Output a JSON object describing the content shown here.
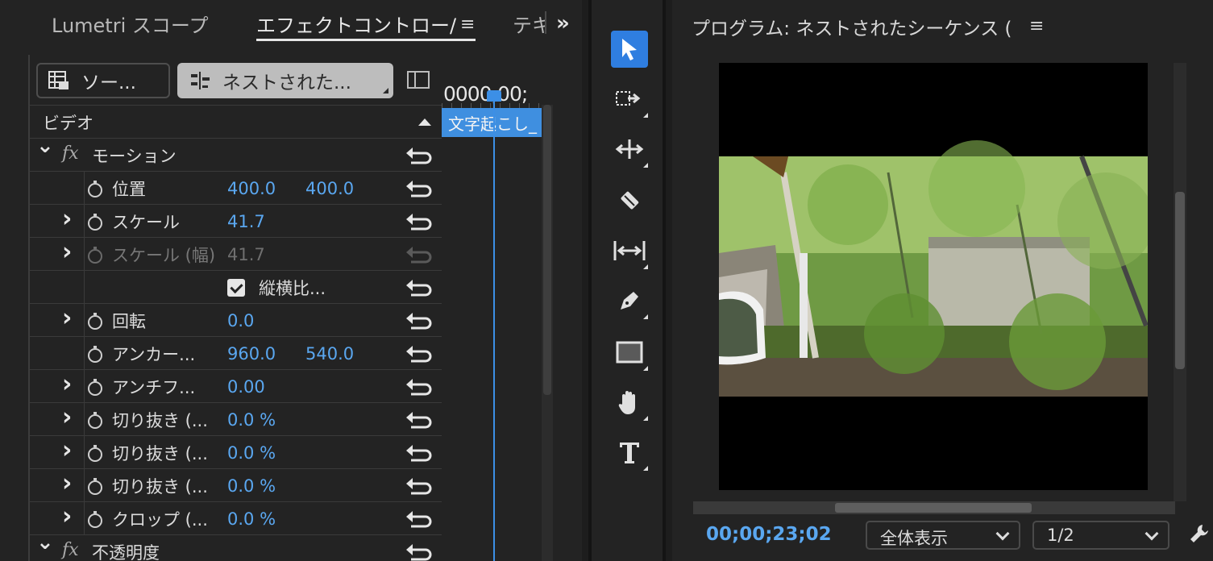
{
  "tabs": {
    "lumetri": "Lumetri スコープ",
    "effect_controls": "エフェクトコントロー/",
    "text": "テキ",
    "more_icon": "chevrons-right-icon",
    "menu_icon": "hamburger-icon"
  },
  "effect_controls": {
    "source_button": "ソー...",
    "sequence_button": "ネストされた...",
    "section_video": "ビデオ",
    "rows": [
      {
        "type": "group",
        "name": "モーション"
      },
      {
        "type": "prop",
        "name": "位置",
        "v1": "400.0",
        "v2": "400.0"
      },
      {
        "type": "prop",
        "name": "スケール",
        "v1": "41.7",
        "v2": ""
      },
      {
        "type": "prop",
        "name": "スケール (幅)",
        "v1": "41.7",
        "v2": "",
        "disabled": true
      },
      {
        "type": "check",
        "name": "縦横比..."
      },
      {
        "type": "prop",
        "name": "回転",
        "v1": "0.0",
        "v2": ""
      },
      {
        "type": "prop",
        "name": "アンカー...",
        "v1": "960.0",
        "v2": "540.0"
      },
      {
        "type": "prop",
        "name": "アンチフ...",
        "v1": "0.00",
        "v2": ""
      },
      {
        "type": "prop",
        "name": "切り抜き (...",
        "v1": "0.0 %",
        "v2": ""
      },
      {
        "type": "prop",
        "name": "切り抜き (...",
        "v1": "0.0 %",
        "v2": ""
      },
      {
        "type": "prop",
        "name": "切り抜き (...",
        "v1": "0.0 %",
        "v2": ""
      },
      {
        "type": "prop",
        "name": "クロップ (...",
        "v1": "0.0 %",
        "v2": ""
      },
      {
        "type": "group",
        "name": "不透明度"
      }
    ]
  },
  "timeline": {
    "time": "0000;00;",
    "clip": "文字起こし_"
  },
  "tools": [
    "selection-tool",
    "track-select-tool",
    "ripple-edit-tool",
    "razor-tool",
    "slip-tool",
    "pen-tool",
    "rectangle-tool",
    "hand-tool",
    "type-tool"
  ],
  "program": {
    "title": "プログラム: ネストされたシーケンス (",
    "timecode": "00;00;23;02",
    "zoom": "全体表示",
    "resolution": "1/2"
  },
  "colors": {
    "accent": "#2f7ee0",
    "value": "#5aa7f0",
    "panel": "#232323"
  }
}
